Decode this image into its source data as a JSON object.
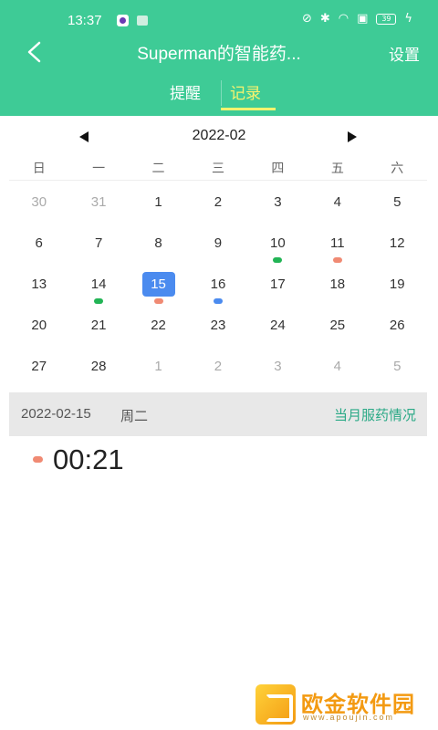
{
  "status_bar": {
    "time": "13:37",
    "battery": "39"
  },
  "header": {
    "title": "Superman的智能药...",
    "settings_label": "设置",
    "bg_color": "#3ecb96"
  },
  "tabs": [
    {
      "label": "提醒",
      "active": false
    },
    {
      "label": "记录",
      "active": true,
      "color": "#f8f36e"
    }
  ],
  "calendar": {
    "month_label": "2022-02",
    "weekdays": [
      "日",
      "一",
      "二",
      "三",
      "四",
      "五",
      "六"
    ],
    "weeks": [
      [
        {
          "d": "30",
          "muted": true
        },
        {
          "d": "31",
          "muted": true
        },
        {
          "d": "1"
        },
        {
          "d": "2"
        },
        {
          "d": "3"
        },
        {
          "d": "4"
        },
        {
          "d": "5"
        }
      ],
      [
        {
          "d": "6"
        },
        {
          "d": "7"
        },
        {
          "d": "8"
        },
        {
          "d": "9"
        },
        {
          "d": "10",
          "dot": "#22b455"
        },
        {
          "d": "11",
          "dot": "#f08a73"
        },
        {
          "d": "12"
        }
      ],
      [
        {
          "d": "13"
        },
        {
          "d": "14",
          "dot": "#22b455"
        },
        {
          "d": "15",
          "selected": true,
          "dot": "#f08a73"
        },
        {
          "d": "16",
          "dot": "#4b8bef"
        },
        {
          "d": "17"
        },
        {
          "d": "18"
        },
        {
          "d": "19"
        }
      ],
      [
        {
          "d": "20"
        },
        {
          "d": "21"
        },
        {
          "d": "22"
        },
        {
          "d": "23"
        },
        {
          "d": "24"
        },
        {
          "d": "25"
        },
        {
          "d": "26"
        }
      ],
      [
        {
          "d": "27"
        },
        {
          "d": "28"
        },
        {
          "d": "1",
          "muted": true
        },
        {
          "d": "2",
          "muted": true
        },
        {
          "d": "3",
          "muted": true
        },
        {
          "d": "4",
          "muted": true
        },
        {
          "d": "5",
          "muted": true
        }
      ]
    ],
    "selected_color": "#4b8bef"
  },
  "day_detail": {
    "date": "2022-02-15",
    "weekday": "周二",
    "month_link": "当月服药情况",
    "records": [
      {
        "time": "00:21",
        "color": "#f08a73"
      }
    ]
  },
  "watermark": {
    "name": "欧金软件园",
    "url": "www.apoujin.com"
  }
}
